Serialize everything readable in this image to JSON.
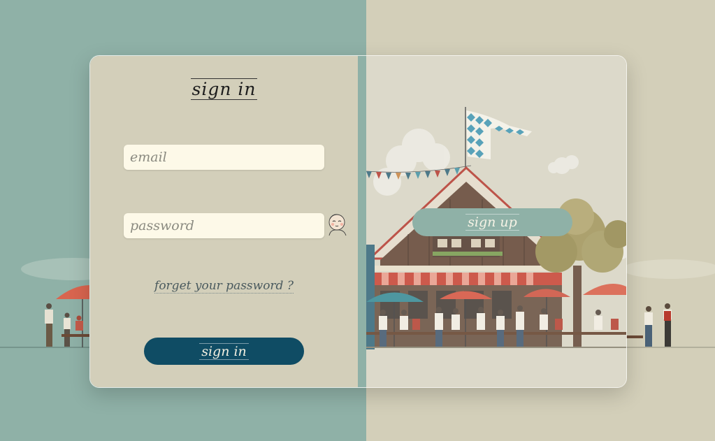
{
  "login": {
    "title": "sign in",
    "email_placeholder": "email",
    "password_placeholder": "password",
    "forgot_link": "forget your password ?",
    "submit_label": "sign in"
  },
  "switch_panel": {
    "signup_label": "sign up"
  },
  "colors": {
    "teal_background": "#8fb1a7",
    "beige_background": "#d3cfb9",
    "input_background": "#fdf9e8",
    "sign_in_button": "#0f4c64",
    "sign_up_button": "#8fb1a7"
  },
  "icons": {
    "password_toggle": "peeking-face-icon"
  }
}
